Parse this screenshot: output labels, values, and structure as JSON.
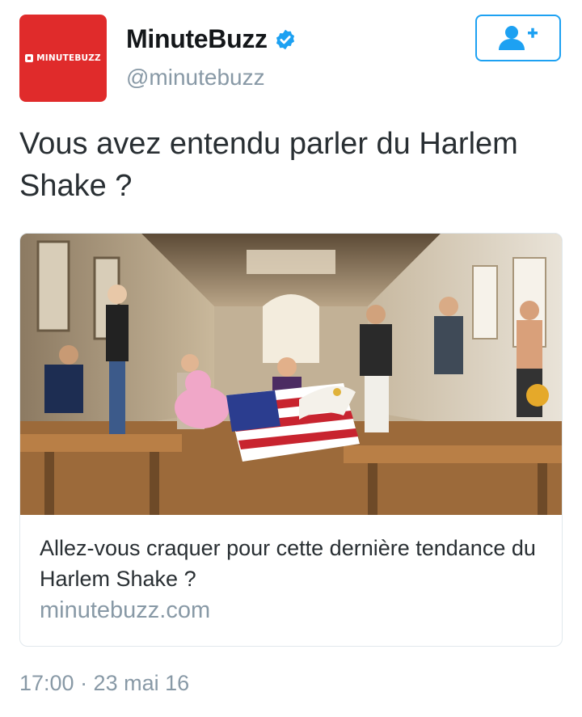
{
  "author": {
    "avatar_text": "MINUTEBUZZ",
    "display_name": "MinuteBuzz",
    "handle": "@minutebuzz",
    "verified": true
  },
  "follow_button": {
    "icon": "follow-user-plus-icon"
  },
  "tweet": {
    "text": "Vous avez entendu parler du Harlem Shake ?",
    "timestamp": "17:00 · 23 mai 16"
  },
  "card": {
    "image": "photo of students dancing in a library hall, one waving a US flag",
    "title": "Allez-vous craquer pour cette dernière tendance du Harlem Shake ?",
    "domain": "minutebuzz.com"
  },
  "colors": {
    "brand_red": "#e02b2b",
    "twitter_blue": "#1da1f2",
    "text_dark": "#292f33",
    "text_gray": "#8899a6",
    "border": "#e1e8ed"
  }
}
